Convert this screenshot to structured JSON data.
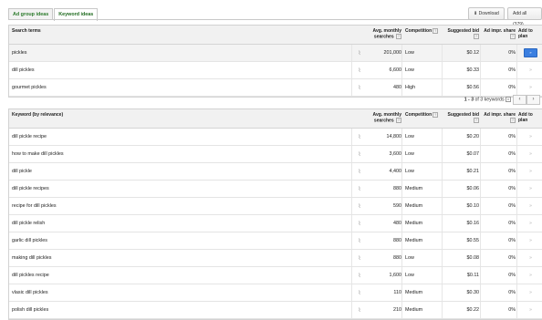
{
  "tabs": [
    "Ad group ideas",
    "Keyword ideas"
  ],
  "toolbar": {
    "download": "Download",
    "add_all": "Add all (379)"
  },
  "table1": {
    "headers": {
      "term": "Search terms",
      "avg1": "Avg. monthly",
      "avg2": "searches",
      "comp": "Competition",
      "bid": "Suggested bid",
      "share": "Ad impr. share",
      "add": "Add to plan"
    },
    "rows": [
      {
        "term": "pickles",
        "avg": "201,000",
        "comp": "Low",
        "bid": "$0.12",
        "share": "0%"
      },
      {
        "term": "dill pickles",
        "avg": "6,600",
        "comp": "Low",
        "bid": "$0.33",
        "share": "0%"
      },
      {
        "term": "gourmet pickles",
        "avg": "480",
        "comp": "High",
        "bid": "$0.56",
        "share": "0%"
      }
    ]
  },
  "pager": {
    "prefix": "1 - 3",
    "suffix": " of 3 keywords"
  },
  "table2": {
    "headers": {
      "term": "Keyword (by relevance)",
      "avg1": "Avg. monthly",
      "avg2": "searches",
      "comp": "Competition",
      "bid": "Suggested bid",
      "share": "Ad impr. share",
      "add": "Add to plan"
    },
    "rows": [
      {
        "term": "dill pickle recipe",
        "avg": "14,800",
        "comp": "Low",
        "bid": "$0.20",
        "share": "0%"
      },
      {
        "term": "how to make dill pickles",
        "avg": "3,600",
        "comp": "Low",
        "bid": "$0.07",
        "share": "0%"
      },
      {
        "term": "dill pickle",
        "avg": "4,400",
        "comp": "Low",
        "bid": "$0.21",
        "share": "0%"
      },
      {
        "term": "dill pickle recipes",
        "avg": "880",
        "comp": "Medium",
        "bid": "$0.06",
        "share": "0%"
      },
      {
        "term": "recipe for dill pickles",
        "avg": "590",
        "comp": "Medium",
        "bid": "$0.10",
        "share": "0%"
      },
      {
        "term": "dill pickle relish",
        "avg": "480",
        "comp": "Medium",
        "bid": "$0.16",
        "share": "0%"
      },
      {
        "term": "garlic dill pickles",
        "avg": "880",
        "comp": "Medium",
        "bid": "$0.55",
        "share": "0%"
      },
      {
        "term": "making dill pickles",
        "avg": "880",
        "comp": "Low",
        "bid": "$0.08",
        "share": "0%"
      },
      {
        "term": "dill pickles recipe",
        "avg": "1,600",
        "comp": "Low",
        "bid": "$0.11",
        "share": "0%"
      },
      {
        "term": "vlasic dill pickles",
        "avg": "110",
        "comp": "Medium",
        "bid": "$0.30",
        "share": "0%"
      },
      {
        "term": "polish dill pickles",
        "avg": "210",
        "comp": "Medium",
        "bid": "$0.22",
        "share": "0%"
      }
    ]
  },
  "icons": {
    "trend": "chart-icon",
    "add": "add-to-plan-icon",
    "help": "help-icon"
  },
  "colors": {
    "tab_green": "#1f6b1f",
    "add_button": "#3b7fe0"
  }
}
